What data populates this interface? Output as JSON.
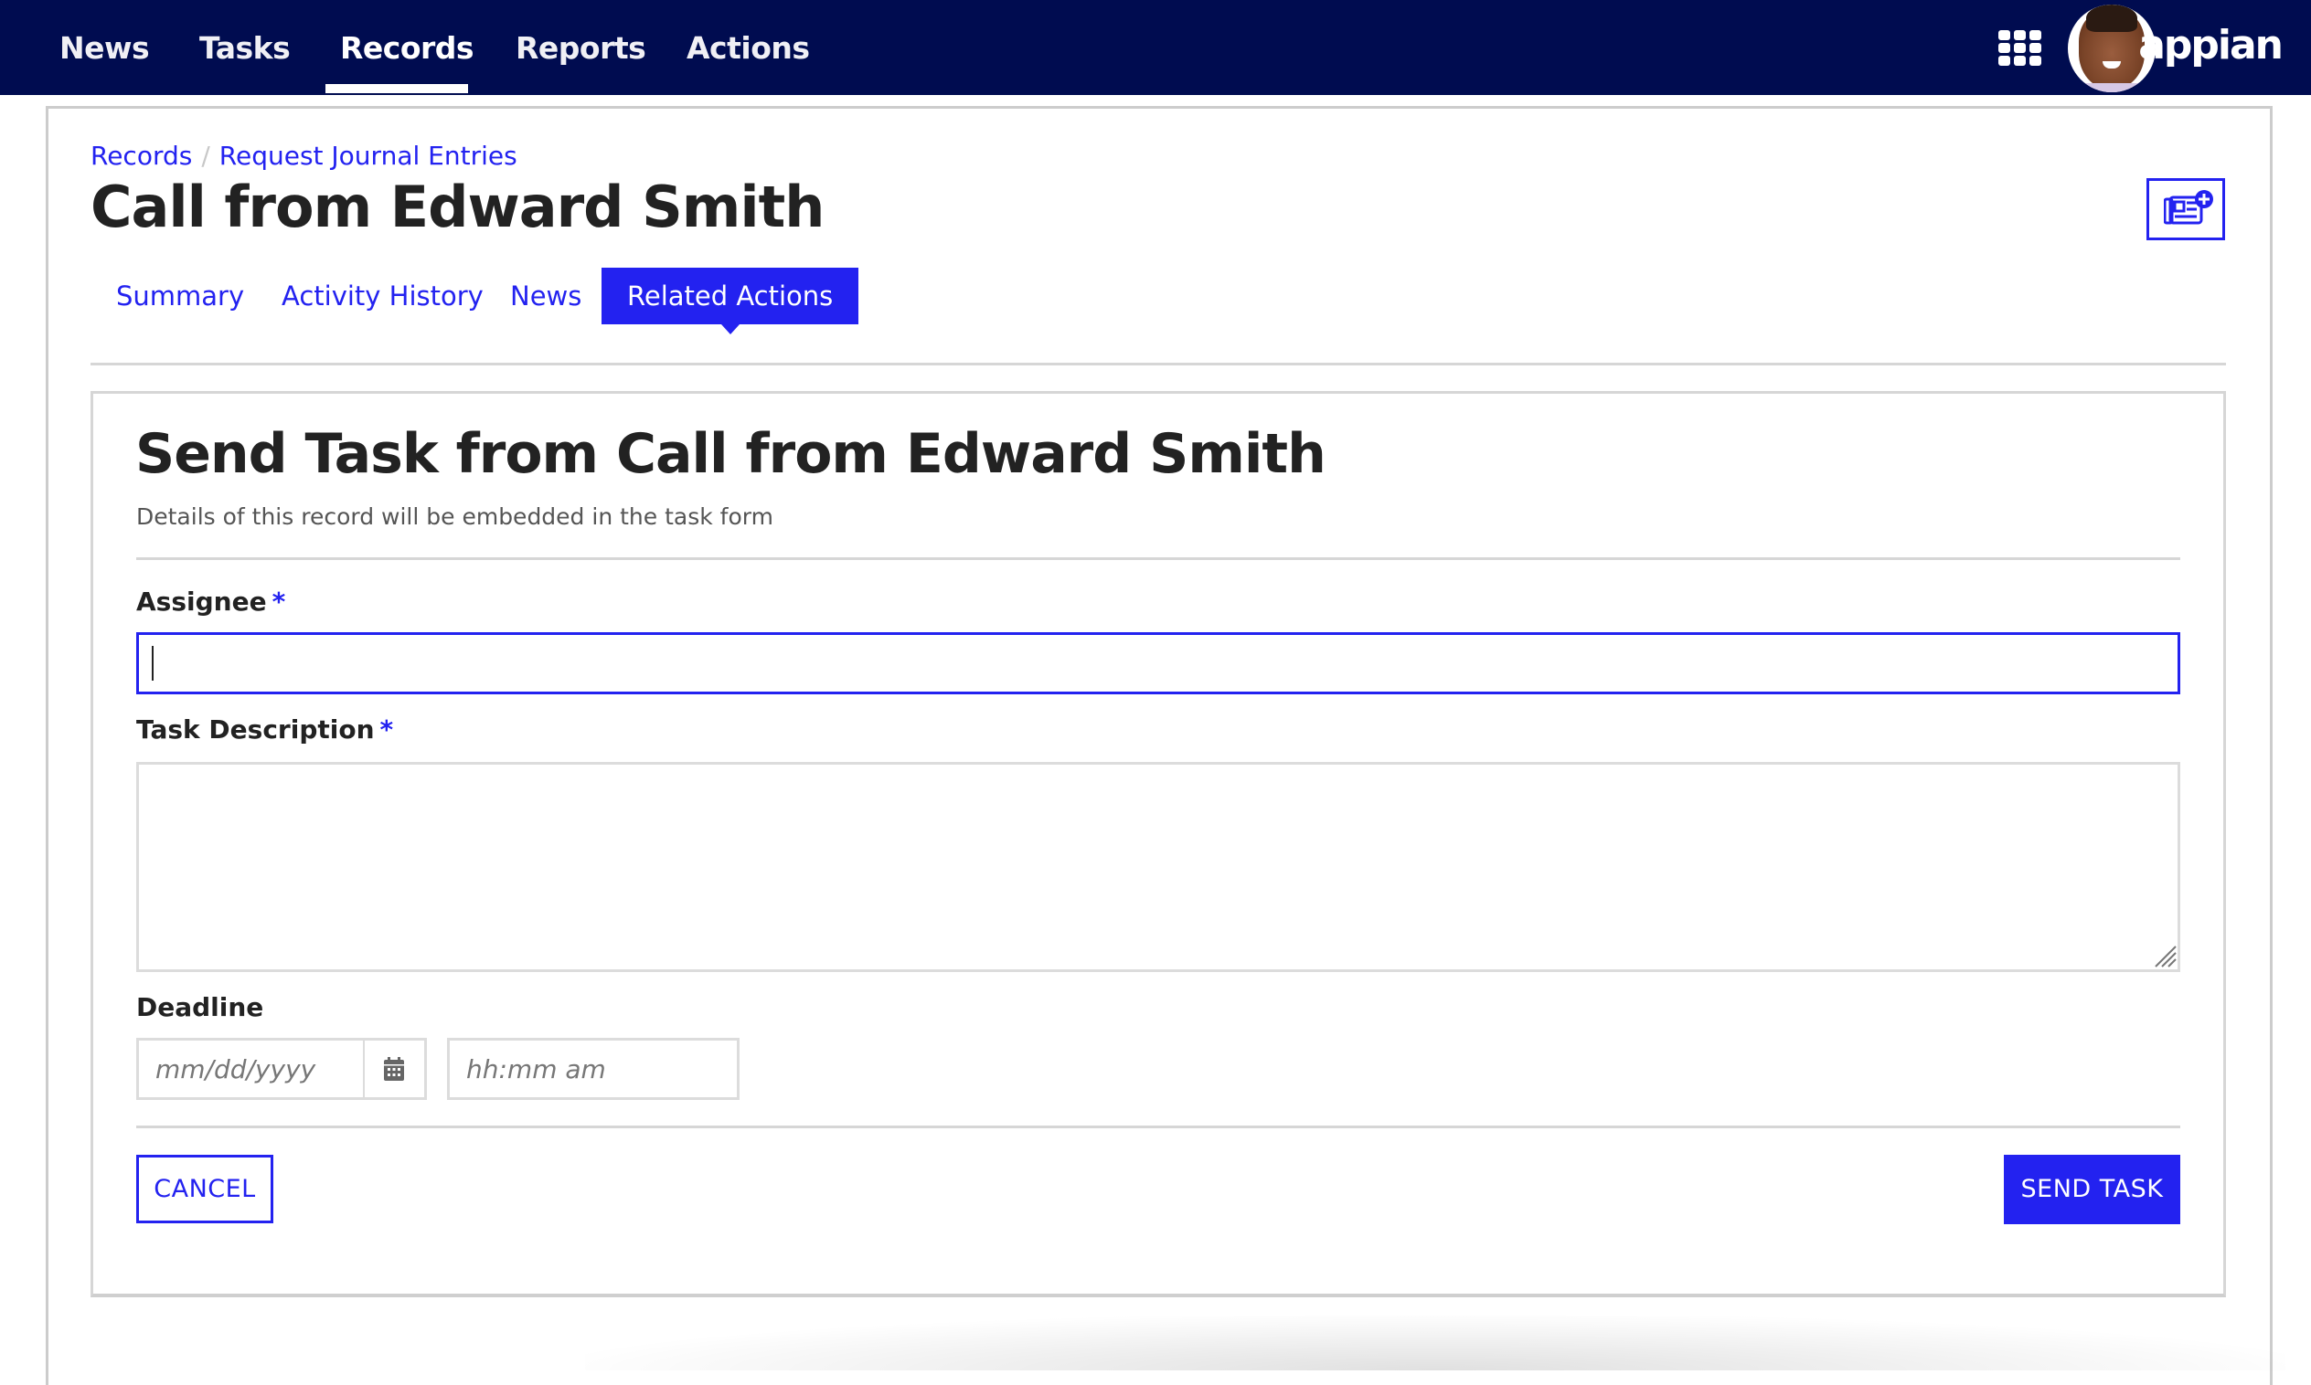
{
  "topnav": {
    "items": [
      {
        "label": "News",
        "active": false
      },
      {
        "label": "Tasks",
        "active": false
      },
      {
        "label": "Records",
        "active": true
      },
      {
        "label": "Reports",
        "active": false
      },
      {
        "label": "Actions",
        "active": false
      }
    ],
    "apps_icon": "grid-9-icon",
    "avatar": "user-avatar",
    "logo_text": "appian",
    "colors": {
      "bar": "#000c50",
      "accent": "#2322f0"
    }
  },
  "breadcrumb": {
    "items": [
      "Records",
      "Request Journal Entries"
    ],
    "separator": "/"
  },
  "record": {
    "title": "Call from Edward Smith",
    "news_button_icon": "newspaper-plus-icon"
  },
  "tabs": [
    {
      "label": "Summary",
      "active": false
    },
    {
      "label": "Activity History",
      "active": false
    },
    {
      "label": "News",
      "active": false
    },
    {
      "label": "Related Actions",
      "active": true
    }
  ],
  "form": {
    "title": "Send Task from Call from Edward Smith",
    "subtitle": "Details of this record will be embedded in the task form",
    "fields": {
      "assignee": {
        "label": "Assignee",
        "required_marker": "*",
        "value": ""
      },
      "description": {
        "label": "Task Description",
        "required_marker": "*",
        "value": ""
      },
      "deadline": {
        "label": "Deadline",
        "date_placeholder": "mm/dd/yyyy",
        "date_value": "",
        "time_placeholder": "hh:mm am",
        "time_value": "",
        "calendar_icon": "calendar-icon"
      }
    },
    "buttons": {
      "cancel": "CANCEL",
      "submit": "SEND TASK"
    }
  }
}
